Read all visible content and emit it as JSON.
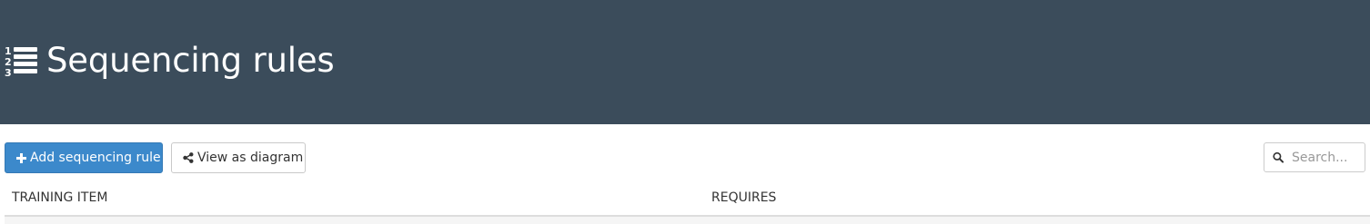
{
  "header": {
    "title": "Sequencing rules",
    "icon": "ordered-list-icon",
    "background": "#3b4c5b"
  },
  "toolbar": {
    "add_label": "Add sequencing rule",
    "add_icon": "plus-icon",
    "add_color": "#3c89cb",
    "diagram_label": "View as diagram",
    "diagram_icon": "share-nodes-icon"
  },
  "search": {
    "placeholder": "Search...",
    "value": "",
    "icon": "search-icon"
  },
  "table": {
    "columns": [
      "TRAINING ITEM",
      "REQUIRES"
    ]
  }
}
